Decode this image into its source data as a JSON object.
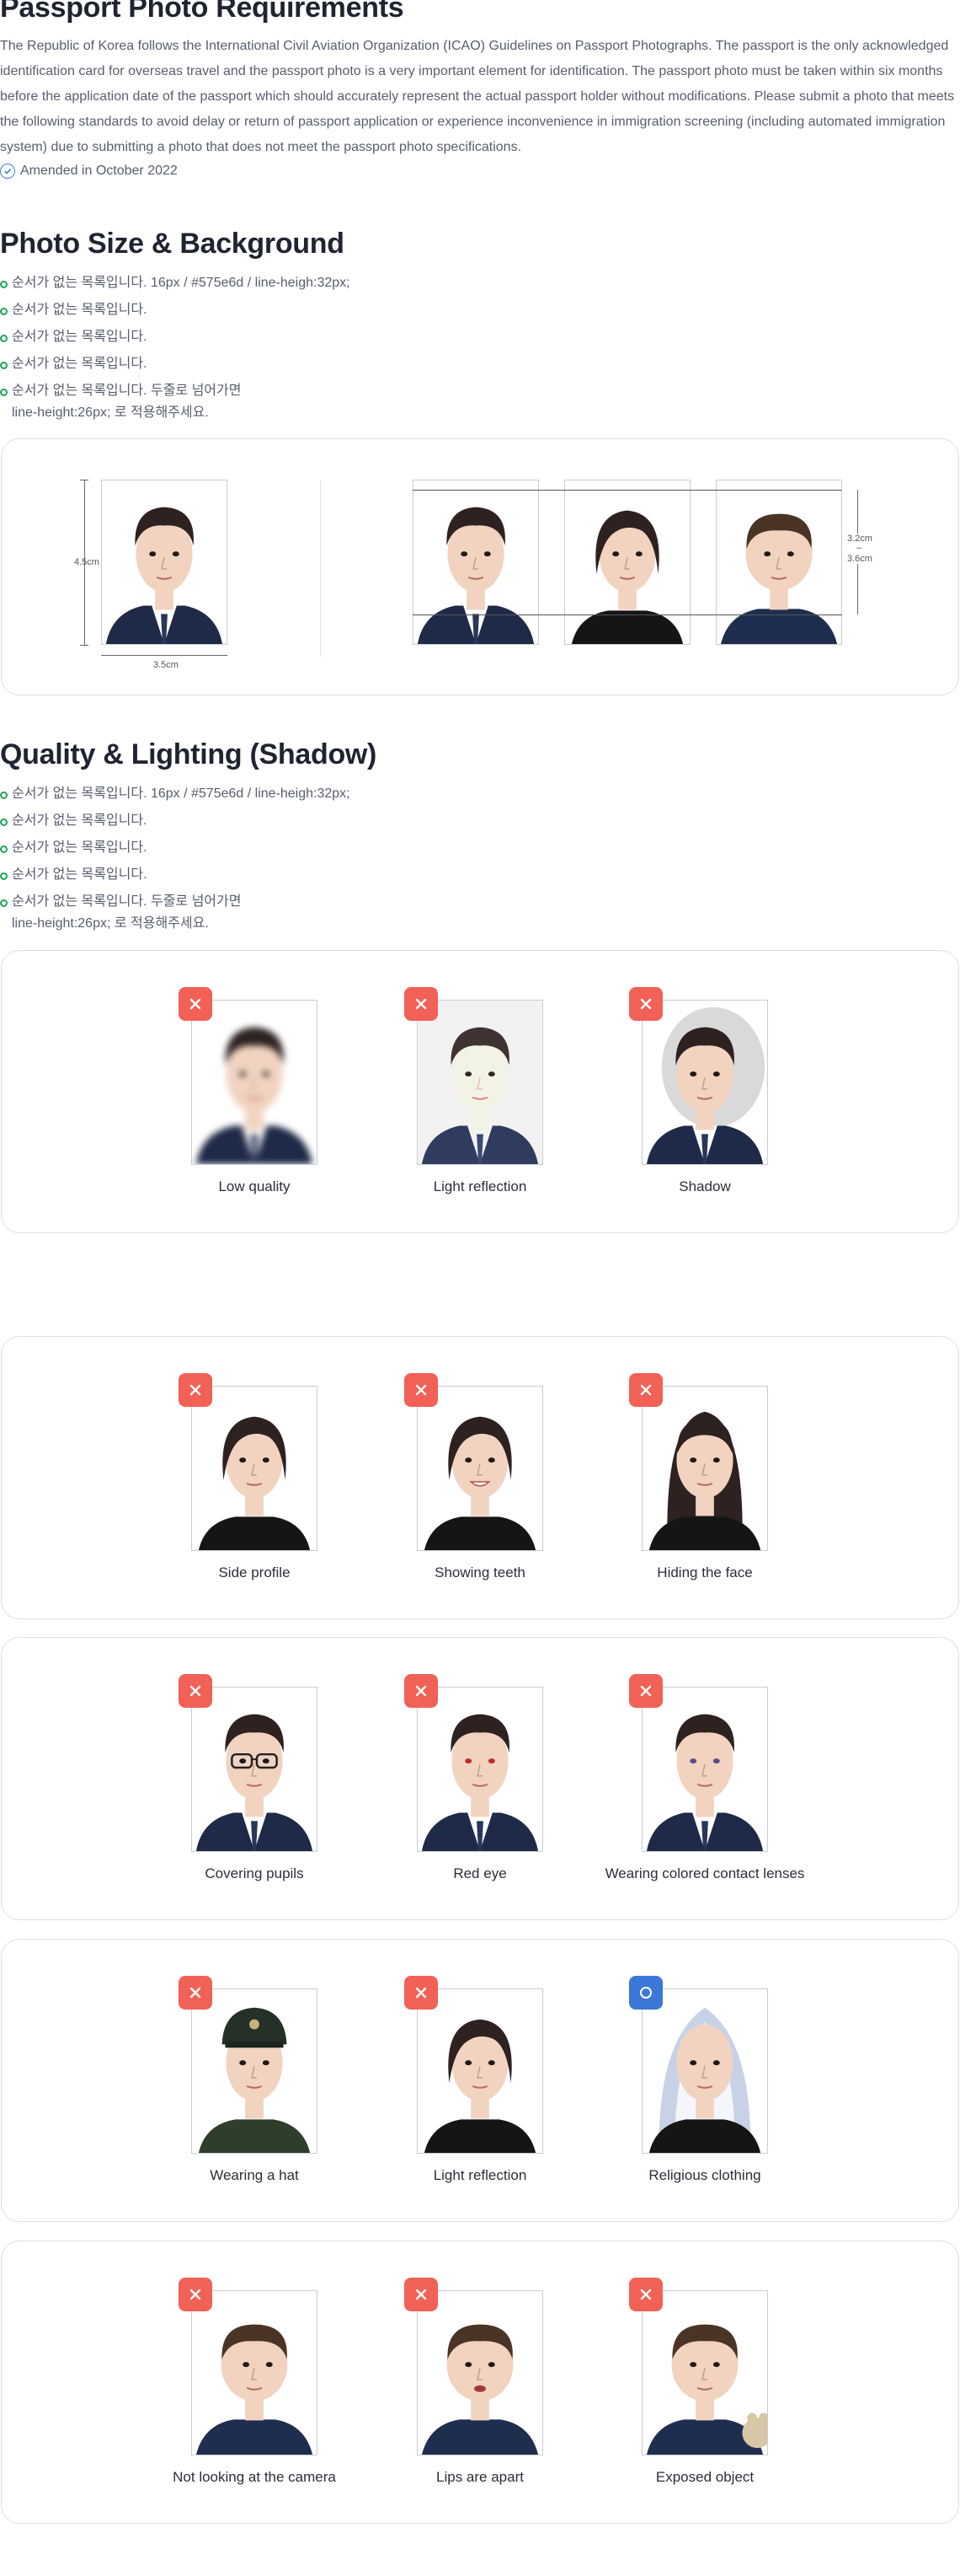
{
  "title": "Passport Photo Requirements",
  "intro": "The Republic of Korea follows the International Civil Aviation Organization (ICAO) Guidelines on Passport Photographs. The passport is the only acknowledged identification card for overseas travel and the passport photo is a very important element for identification. The passport photo must be taken within six months before the application date of the passport which should accurately represent the actual passport holder without modifications. Please submit a photo that meets the following standards to avoid delay or return of passport application or experience inconvenience in immigration screening (including automated immigration system) due to submitting a photo that does not meet the passport photo specifications.",
  "amended": "Amended in October 2022",
  "section1": {
    "heading": "Photo Size & Background",
    "bullets": [
      "순서가 없는 목록입니다. 16px / #575e6d / line-heigh:32px;",
      "순서가 없는 목록입니다.",
      "순서가 없는 목록입니다.",
      "순서가 없는 목록입니다.",
      "순서가 없는 목록입니다. 두줄로 넘어가면",
      "line-height:26px; 로 적용해주세요."
    ],
    "dims": {
      "height": "4.5cm",
      "width": "3.5cm",
      "head_top": "3.2cm",
      "head_tilde": "~",
      "head_bottom": "3.6cm"
    }
  },
  "section2": {
    "heading": "Quality & Lighting (Shadow)",
    "bullets": [
      "순서가 없는 목록입니다. 16px / #575e6d / line-heigh:32px;",
      "순서가 없는 목록입니다.",
      "순서가 없는 목록입니다.",
      "순서가 없는 목록입니다.",
      "순서가 없는 목록입니다. 두줄로 넘어가면",
      "line-height:26px; 로 적용해주세요."
    ]
  },
  "groups": [
    {
      "captions": [
        "Low quality",
        "Light reflection",
        "Shadow"
      ],
      "badges": [
        "x",
        "x",
        "x"
      ]
    },
    {
      "captions": [
        "Side profile",
        "Showing teeth",
        "Hiding the face"
      ],
      "badges": [
        "x",
        "x",
        "x"
      ]
    },
    {
      "captions": [
        "Covering pupils",
        "Red eye",
        "Wearing colored contact lenses"
      ],
      "badges": [
        "x",
        "x",
        "x"
      ]
    },
    {
      "captions": [
        "Wearing a hat",
        "Light reflection",
        "Religious clothing"
      ],
      "badges": [
        "x",
        "x",
        "o"
      ]
    },
    {
      "captions": [
        "Not looking at the camera",
        "Lips are apart",
        "Exposed object"
      ],
      "badges": [
        "x",
        "x",
        "x"
      ]
    }
  ],
  "colors": {
    "bad": "#f16156",
    "good": "#3b78d8",
    "bullet": "#22a35a",
    "text": "#575e6d"
  }
}
